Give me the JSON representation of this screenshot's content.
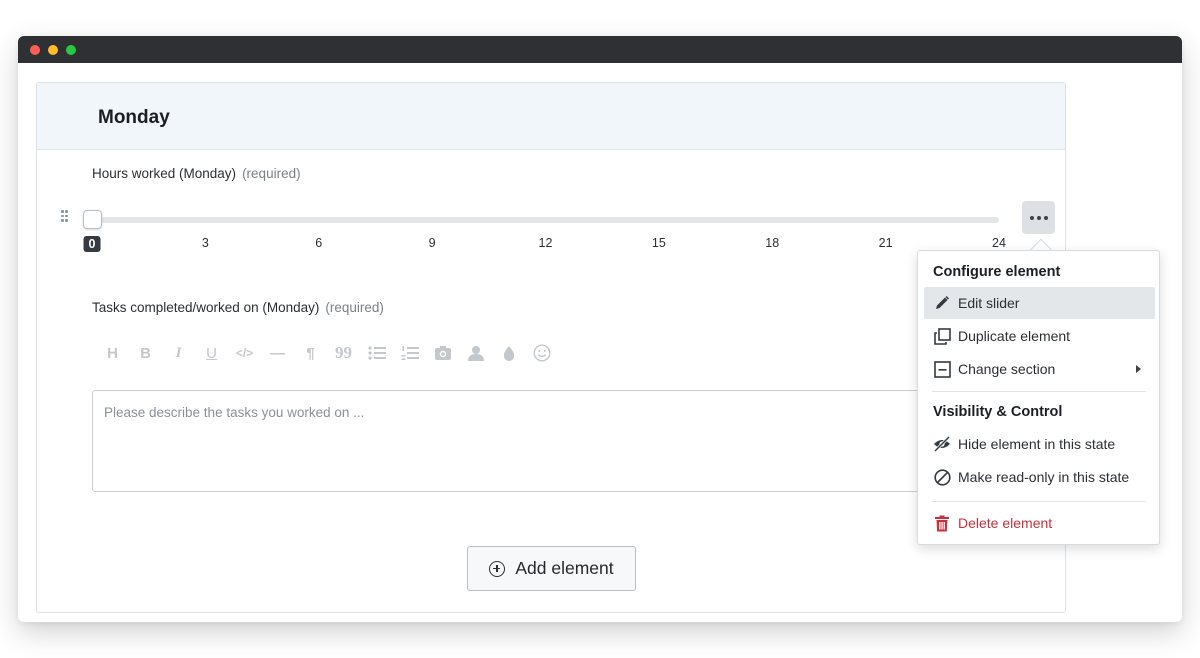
{
  "section": {
    "title": "Monday"
  },
  "slider_field": {
    "label": "Hours worked (Monday)",
    "required": "(required)",
    "value": 0,
    "min": 0,
    "max": 24,
    "ticks": [
      "0",
      "3",
      "6",
      "9",
      "12",
      "15",
      "18",
      "21",
      "24"
    ]
  },
  "tasks_field": {
    "label": "Tasks completed/worked on (Monday)",
    "required": "(required)",
    "placeholder": "Please describe the tasks you worked on ..."
  },
  "toolbar": {
    "heading": "H",
    "bold": "B",
    "italic": "I",
    "underline": "U",
    "code": "</>",
    "rule": "—",
    "paragraph": "¶",
    "quote": "99"
  },
  "add_element": {
    "label": "Add element"
  },
  "context_menu": {
    "configure_heading": "Configure element",
    "edit_slider": "Edit slider",
    "duplicate_element": "Duplicate element",
    "change_section": "Change section",
    "visibility_heading": "Visibility & Control",
    "hide_element": "Hide element in this state",
    "make_readonly": "Make read-only in this state",
    "delete_element": "Delete element"
  },
  "colors": {
    "header_bg": "#f1f6fa",
    "danger": "#c8303c",
    "tick_active_bg": "#343a40",
    "titlebar": "#2f3033"
  }
}
